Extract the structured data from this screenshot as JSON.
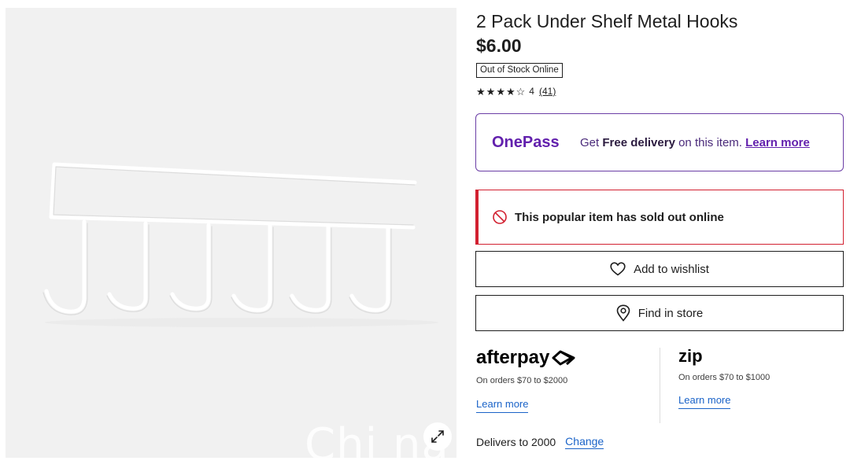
{
  "product": {
    "title": "2 Pack Under Shelf Metal Hooks",
    "price": "$6.00",
    "stock_badge": "Out of Stock Online",
    "rating": {
      "stars_filled": 4,
      "stars_total": 5,
      "score": "4",
      "count": "(41)"
    }
  },
  "image": {
    "expand_icon": "expand-arrows-icon",
    "watermark": "Chi na"
  },
  "onepass": {
    "logo": "OnePass",
    "text_prefix": "Get ",
    "text_bold": "Free delivery",
    "text_suffix": " on this item. ",
    "learn_more": "Learn more",
    "accent_color": "#6220ad"
  },
  "alert": {
    "icon": "prohibited-icon",
    "text": "This popular item has sold out online",
    "color": "#d22030"
  },
  "actions": {
    "wishlist_label": "Add to wishlist",
    "wishlist_icon": "heart-icon",
    "store_label": "Find in store",
    "store_icon": "location-pin-icon"
  },
  "payments": {
    "afterpay": {
      "logo": "afterpay",
      "note": "On orders $70 to $2000",
      "learn_more": "Learn more"
    },
    "zip": {
      "logo": "zip",
      "note": "On orders $70 to $1000",
      "learn_more": "Learn more"
    },
    "link_color": "#1a63c8"
  },
  "delivery": {
    "text": "Delivers to 2000",
    "change": "Change"
  }
}
